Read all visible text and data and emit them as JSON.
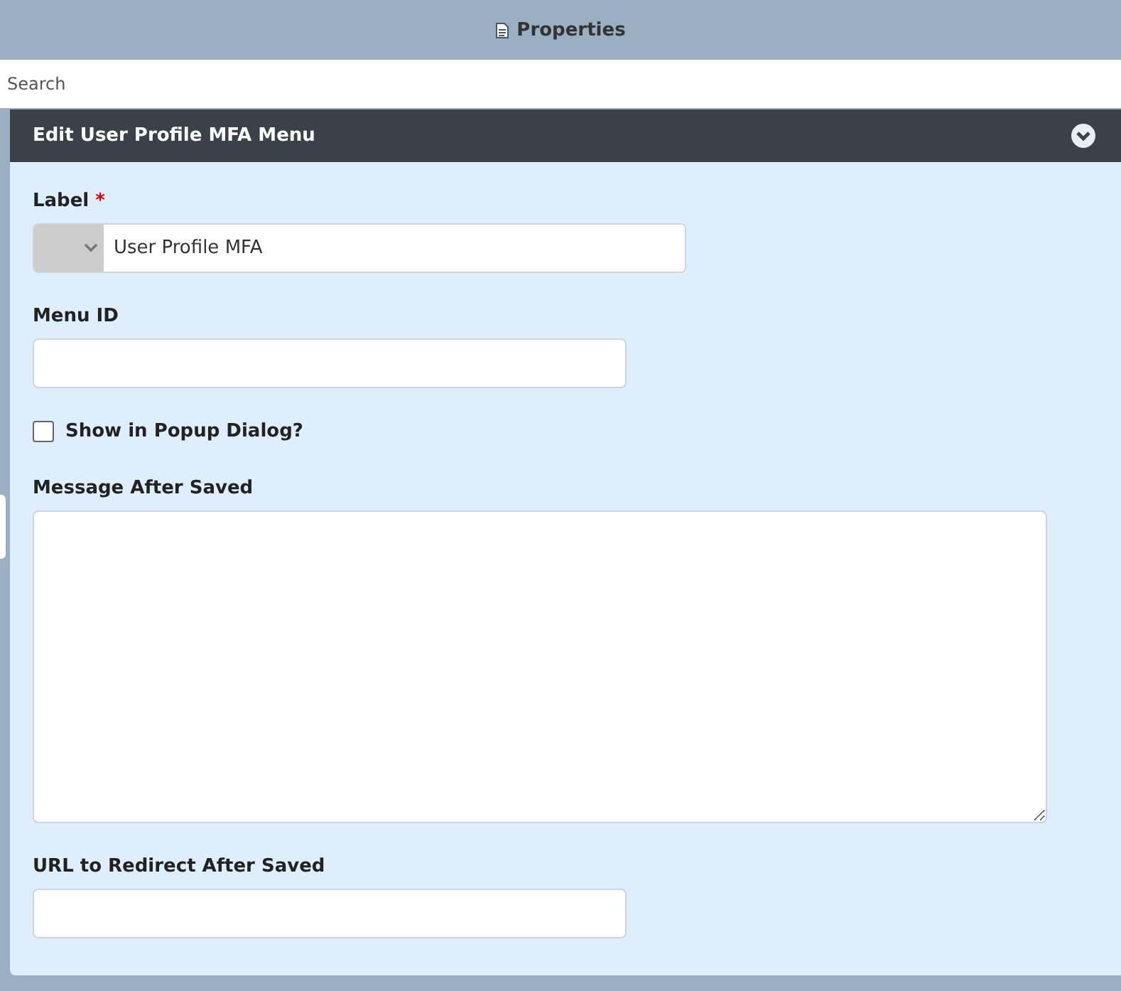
{
  "window": {
    "title": "Properties"
  },
  "search": {
    "placeholder": "Search"
  },
  "panel": {
    "title": "Edit User Profile MFA Menu",
    "expanded": true,
    "fields": [
      {
        "kind": "select-text",
        "label": "Label",
        "required_mark": "*",
        "value": "User Profile MFA"
      },
      {
        "kind": "text",
        "label": "Menu ID"
      },
      {
        "kind": "checkbox",
        "label": "Show in Popup Dialog?",
        "checked": false
      },
      {
        "kind": "textarea",
        "label": "Message After Saved"
      },
      {
        "kind": "text",
        "label": "URL to Redirect After Saved"
      }
    ]
  }
}
